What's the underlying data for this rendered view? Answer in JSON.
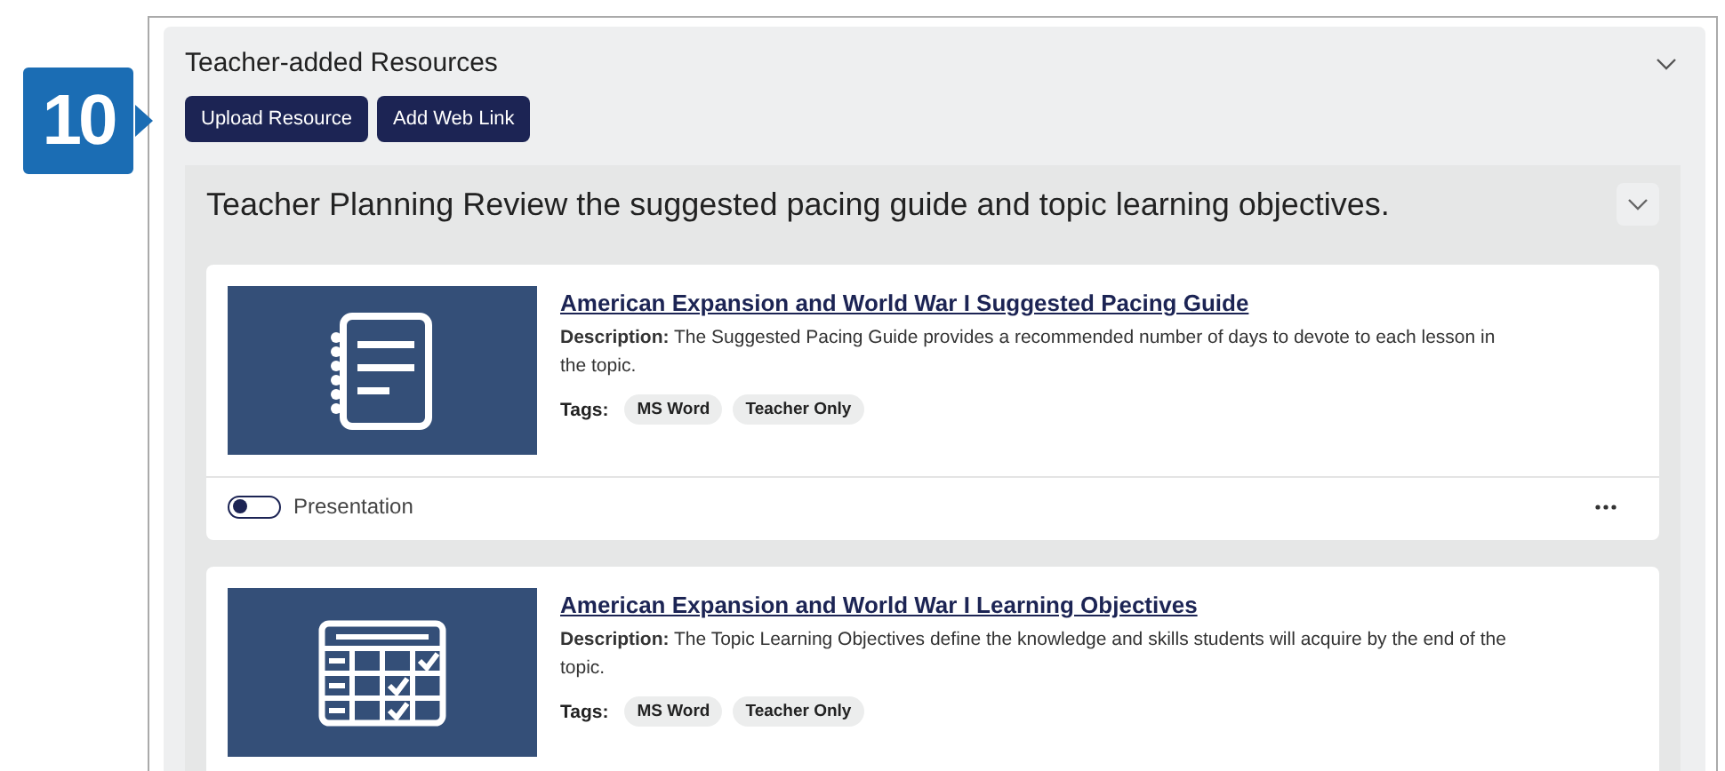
{
  "step_badge": "10",
  "panel": {
    "title": "Teacher-added Resources",
    "expanded": true,
    "buttons": [
      "Upload Resource",
      "Add Web Link"
    ]
  },
  "section": {
    "title": "Teacher Planning Review the suggested pacing guide and topic learning objectives.",
    "expanded": true
  },
  "resources": [
    {
      "kind": "document",
      "title": "American Expansion and World War I Suggested Pacing Guide",
      "description_label": "Description:",
      "description": "The Suggested Pacing Guide provides a recommended number of days to devote to each lesson in the topic.",
      "tags_label": "Tags:",
      "tags": [
        "MS Word",
        "Teacher Only"
      ],
      "toggle": {
        "label": "Presentation",
        "on": false
      }
    },
    {
      "kind": "checklist",
      "title": "American Expansion and World War I Learning Objectives",
      "description_label": "Description:",
      "description": "The Topic Learning Objectives define the knowledge and skills students will acquire by the end of the topic.",
      "tags_label": "Tags:",
      "tags": [
        "MS Word",
        "Teacher Only"
      ]
    }
  ]
}
